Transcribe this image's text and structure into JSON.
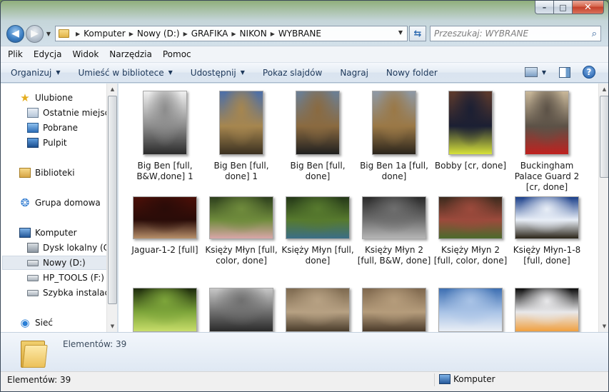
{
  "window": {
    "minimize_glyph": "–",
    "maximize_glyph": "□",
    "close_glyph": "✕"
  },
  "navigation": {
    "back_icon": "arrow-left-icon",
    "forward_icon": "arrow-right-icon",
    "breadcrumb": [
      "Komputer",
      "Nowy (D:)",
      "GRAFIKA",
      "NIKON",
      "WYBRANE"
    ],
    "search_placeholder": "Przeszukaj: WYBRANE"
  },
  "menubar": [
    "Plik",
    "Edycja",
    "Widok",
    "Narzędzia",
    "Pomoc"
  ],
  "commandbar": {
    "items": [
      {
        "label": "Organizuj",
        "dropdown": true
      },
      {
        "label": "Umieść w bibliotece",
        "dropdown": true
      },
      {
        "label": "Udostępnij",
        "dropdown": true
      },
      {
        "label": "Pokaz slajdów",
        "dropdown": false
      },
      {
        "label": "Nagraj",
        "dropdown": false
      },
      {
        "label": "Nowy folder",
        "dropdown": false
      }
    ],
    "help_glyph": "?"
  },
  "navpane": {
    "favorites": "Ulubione",
    "recent": "Ostatnie miejsca",
    "downloads": "Pobrane",
    "desktop": "Pulpit",
    "libraries": "Biblioteki",
    "homegroup": "Grupa domowa",
    "computer": "Komputer",
    "drive_c": "Dysk lokalny (C:)",
    "drive_d": "Nowy (D:)",
    "drive_f": "HP_TOOLS (F:)",
    "quick_install": "Szybka instalacja",
    "network": "Sieć"
  },
  "files": [
    {
      "name": "Big Ben [full, B&W,done] 1",
      "palette": [
        "#f0f0f0",
        "#8c8c8c",
        "#2a2a2a"
      ]
    },
    {
      "name": "Big Ben [full, done] 1",
      "palette": [
        "#4c6fa8",
        "#a6864f",
        "#3a3020"
      ]
    },
    {
      "name": "Big Ben [full, done]",
      "palette": [
        "#6b7f95",
        "#8a6a40",
        "#1f1f1f"
      ]
    },
    {
      "name": "Big Ben 1a [full, done]",
      "palette": [
        "#8e99a6",
        "#9a7846",
        "#2a241b"
      ]
    },
    {
      "name": "Bobby [cr, done]",
      "palette": [
        "#5d3a2c",
        "#1b1f33",
        "#d7e23a"
      ]
    },
    {
      "name": "Buckingham Palace Guard 2 [cr, done]",
      "palette": [
        "#c9b89a",
        "#5c5247",
        "#c0211e"
      ]
    },
    {
      "name": "Jaguar-1-2 [full]",
      "palette": [
        "#4a0f08",
        "#2a0c08",
        "#b78f6a"
      ]
    },
    {
      "name": "Księży Młyn [full, color, done]",
      "palette": [
        "#2d3f1c",
        "#6f8b3c",
        "#d9a6a8"
      ]
    },
    {
      "name": "Księży Młyn [full, done]",
      "palette": [
        "#243818",
        "#577a2e",
        "#3b6e86"
      ]
    },
    {
      "name": "Księży Młyn 2 [full, B&W, done]",
      "palette": [
        "#2a2a2a",
        "#6e6e6e",
        "#b5b5b5"
      ]
    },
    {
      "name": "Księży Młyn 2 [full, color, done]",
      "palette": [
        "#3c2a1d",
        "#9c4a3c",
        "#4b6a2c"
      ]
    },
    {
      "name": "Księży Młyn-1-8 [full, done]",
      "palette": [
        "#1b3f8a",
        "#e8eef7",
        "#2a2418"
      ]
    },
    {
      "name": "",
      "palette": [
        "#1e2c0d",
        "#7da53a",
        "#c8de6a"
      ]
    },
    {
      "name": "",
      "palette": [
        "#c7c7c7",
        "#6f6f6f",
        "#2a2a2a"
      ]
    },
    {
      "name": "",
      "palette": [
        "#7e6a50",
        "#b7a183",
        "#4a3c2b"
      ]
    },
    {
      "name": "",
      "palette": [
        "#7f684e",
        "#b59c7b",
        "#4b3b2a"
      ]
    },
    {
      "name": "",
      "palette": [
        "#3d6fb2",
        "#a9c3e6",
        "#e9eef5"
      ]
    },
    {
      "name": "",
      "palette": [
        "#0c0c0c",
        "#e8e8ea",
        "#f0a040"
      ]
    }
  ],
  "details": {
    "count_label": "Elementów: 39"
  },
  "statusbar": {
    "left": "Elementów: 39",
    "right": "Komputer"
  }
}
